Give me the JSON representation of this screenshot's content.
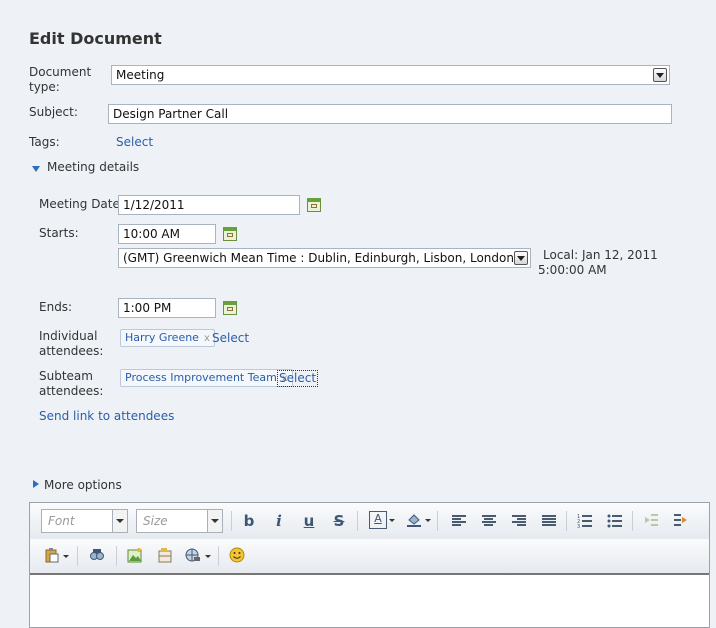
{
  "page": {
    "title": "Edit Document"
  },
  "form": {
    "doc_type": {
      "label": "Document type:",
      "value": "Meeting"
    },
    "subject": {
      "label": "Subject:",
      "value": "Design Partner Call"
    },
    "tags": {
      "label": "Tags:",
      "link": "Select"
    },
    "meeting_details_label": "Meeting details",
    "meeting_date": {
      "label": "Meeting Date:",
      "value": "1/12/2011"
    },
    "starts": {
      "label": "Starts:",
      "value": "10:00 AM"
    },
    "timezone": {
      "value": "(GMT) Greenwich Mean Time : Dublin, Edinburgh, Lisbon, London"
    },
    "local_time": {
      "line1": "Local:  Jan 12, 2011",
      "line2": "5:00:00 AM"
    },
    "ends": {
      "label": "Ends:",
      "value": "1:00 PM"
    },
    "individual": {
      "label": "Individual attendees:",
      "chip": "Harry Greene",
      "link": "Select"
    },
    "subteam": {
      "label": "Subteam attendees:",
      "chip": "Process Improvement Team",
      "link": "Select"
    },
    "send_link": "Send link to attendees",
    "more_options": "More options",
    "remove_glyph": "x"
  },
  "editor": {
    "font_placeholder": "Font",
    "size_placeholder": "Size",
    "bold": "b",
    "italic": "i",
    "underline": "u",
    "strike": "S",
    "text_color_label": "A"
  },
  "colors": {
    "link": "#2a5ea8",
    "background": "#eef2f7"
  }
}
